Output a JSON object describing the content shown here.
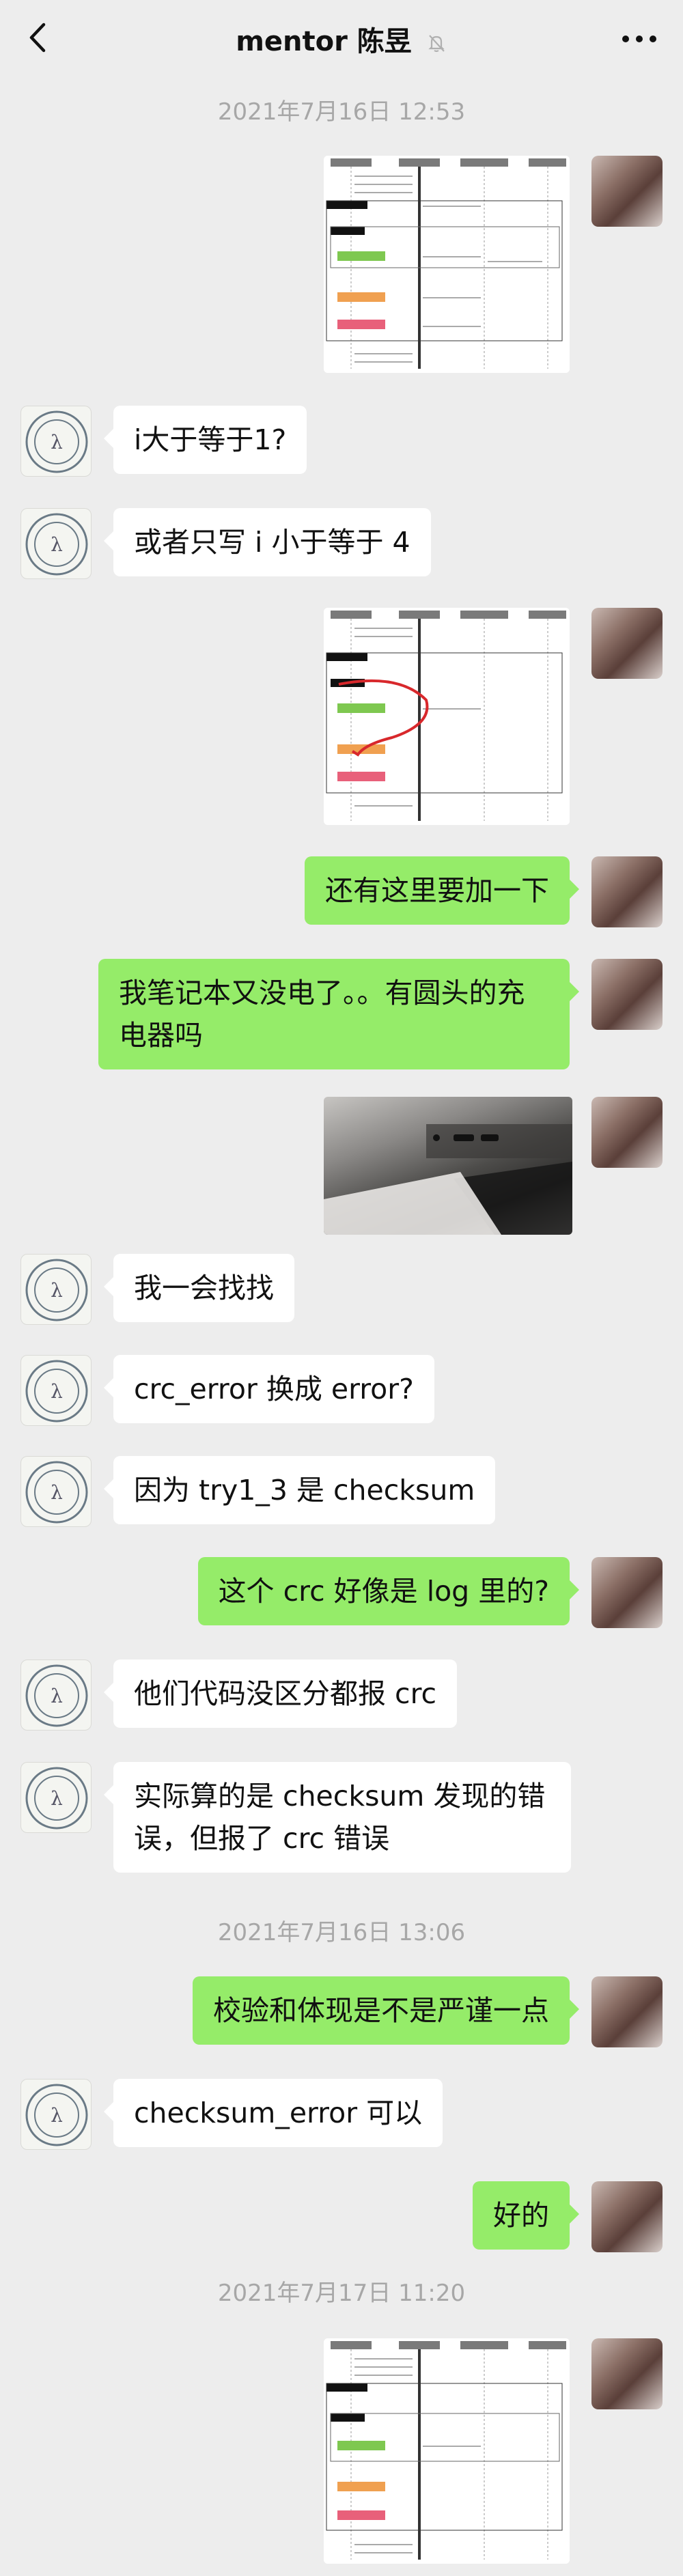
{
  "header": {
    "title": "mentor 陈昱",
    "back_icon": "chevron-left-icon",
    "mute_icon": "bell-off-icon",
    "more_icon": "more-dots-icon"
  },
  "timestamps": [
    "2021年7月16日 12:53",
    "2021年7月16日 13:06",
    "2021年7月17日 11:20"
  ],
  "messages": [
    {
      "side": "right",
      "type": "image",
      "desc": "sequence-diagram"
    },
    {
      "side": "left",
      "type": "text",
      "text": "i大于等于1?"
    },
    {
      "side": "left",
      "type": "text",
      "text": "或者只写 i 小于等于 4"
    },
    {
      "side": "right",
      "type": "image",
      "desc": "sequence-diagram-annotated"
    },
    {
      "side": "right",
      "type": "text",
      "text": "还有这里要加一下"
    },
    {
      "side": "right",
      "type": "text",
      "text": "我笔记本又没电了。。有圆头的充电器吗"
    },
    {
      "side": "right",
      "type": "image",
      "desc": "laptop-photo"
    },
    {
      "side": "left",
      "type": "text",
      "text": "我一会找找"
    },
    {
      "side": "left",
      "type": "text",
      "text": "crc_error 换成 error?"
    },
    {
      "side": "left",
      "type": "text",
      "text": "因为 try1_3 是 checksum"
    },
    {
      "side": "right",
      "type": "text",
      "text": "这个 crc 好像是 log 里的?"
    },
    {
      "side": "left",
      "type": "text",
      "text": "他们代码没区分都报 crc"
    },
    {
      "side": "left",
      "type": "text",
      "text": "实际算的是 checksum 发现的错误，但报了 crc 错误"
    },
    {
      "side": "right",
      "type": "text",
      "text": "校验和体现是不是严谨一点"
    },
    {
      "side": "left",
      "type": "text",
      "text": "checksum_error 可以"
    },
    {
      "side": "right",
      "type": "text",
      "text": "好的"
    },
    {
      "side": "right",
      "type": "image",
      "desc": "sequence-diagram"
    }
  ],
  "colors": {
    "background": "#ededed",
    "bubble_sent": "#95ec69",
    "bubble_received": "#ffffff",
    "timestamp": "#a7a7a7"
  }
}
